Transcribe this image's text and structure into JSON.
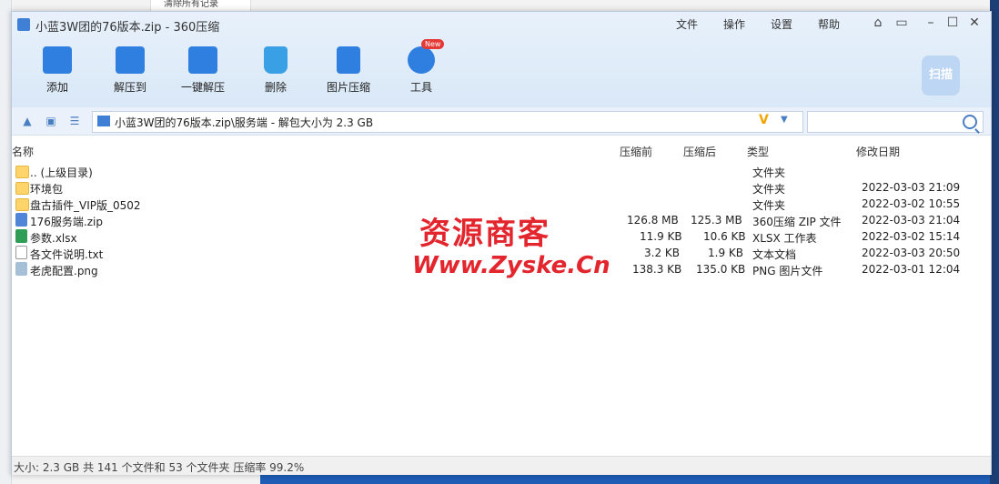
{
  "background": {
    "top_fragment": "清除所有记录"
  },
  "window": {
    "title": "小蓝3W团的76版本.zip - 360压缩",
    "menu": [
      "文件",
      "操作",
      "设置",
      "帮助"
    ]
  },
  "toolbar": {
    "add": "添加",
    "extract_to": "解压到",
    "one_click": "一键解压",
    "delete": "删除",
    "image_compress": "图片压缩",
    "tools": "工具",
    "tools_badge": "New",
    "scan": "扫描"
  },
  "address": {
    "path": "小蓝3W团的76版本.zip\\服务端 - 解包大小为 2.3 GB",
    "search_placeholder": ""
  },
  "columns": {
    "name": "名称",
    "before": "压缩前",
    "after": "压缩后",
    "type": "类型",
    "modified": "修改日期"
  },
  "files": [
    {
      "icon": "folder-icon",
      "name": ".. (上级目录)",
      "before": "",
      "after": "",
      "type": "文件夹",
      "modified": ""
    },
    {
      "icon": "folder-icon",
      "name": "环境包",
      "before": "",
      "after": "",
      "type": "文件夹",
      "modified": "2022-03-03 21:09"
    },
    {
      "icon": "folder-icon",
      "name": "盘古插件_VIP版_0502",
      "before": "",
      "after": "",
      "type": "文件夹",
      "modified": "2022-03-02 10:55"
    },
    {
      "icon": "zip-file-icon",
      "name": "176服务端.zip",
      "before": "126.8 MB",
      "after": "125.3 MB",
      "type": "360压缩 ZIP 文件",
      "modified": "2022-03-03 21:04"
    },
    {
      "icon": "xlsx-file-icon",
      "name": "参数.xlsx",
      "before": "11.9 KB",
      "after": "10.6 KB",
      "type": "XLSX 工作表",
      "modified": "2022-03-02 15:14"
    },
    {
      "icon": "txt-file-icon",
      "name": "各文件说明.txt",
      "before": "3.2 KB",
      "after": "1.9 KB",
      "type": "文本文档",
      "modified": "2022-03-03 20:50"
    },
    {
      "icon": "png-file-icon",
      "name": "老虎配置.png",
      "before": "138.3 KB",
      "after": "135.0 KB",
      "type": "PNG 图片文件",
      "modified": "2022-03-01 12:04"
    }
  ],
  "watermark": {
    "line1": "资源商客",
    "line2": "Www.Zyske.Cn"
  },
  "status": "大小: 2.3 GB 共 141 个文件和 53 个文件夹 压缩率 99.2%"
}
